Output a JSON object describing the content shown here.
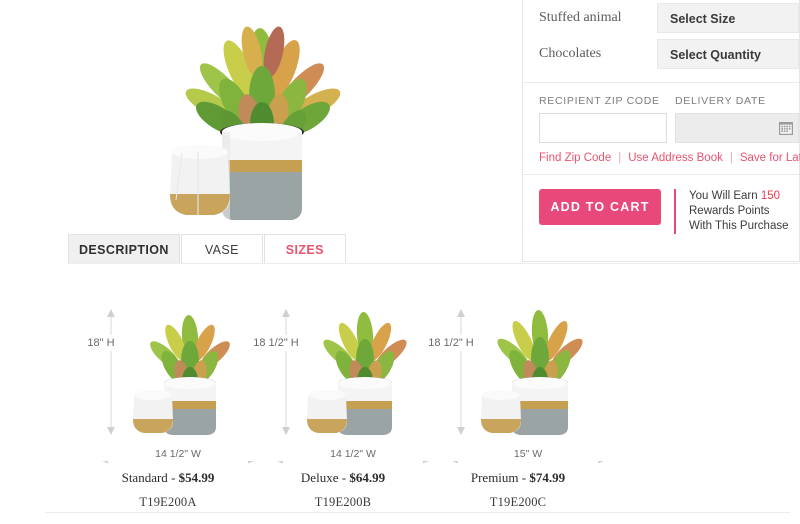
{
  "product": {
    "image_alt": "croton-plant-in-white-grey-gold-ceramic-pot"
  },
  "addons": {
    "rows": [
      {
        "label": "Stuffed animal",
        "select_value": "Select Size"
      },
      {
        "label": "Chocolates",
        "select_value": "Select Quantity"
      }
    ]
  },
  "delivery": {
    "zip_heading": "RECIPIENT ZIP CODE",
    "date_heading": "DELIVERY DATE",
    "zip_value": "",
    "zip_placeholder": "",
    "date_value": "",
    "calendar_icon": "calendar-icon",
    "links": [
      "Find Zip Code",
      "Use Address Book",
      "Save for Later"
    ],
    "link_separator": "|"
  },
  "cart": {
    "add_to_cart_label": "ADD TO CART",
    "rewards_line1_prefix": "You Will Earn ",
    "rewards_points": "150",
    "rewards_line2": "Rewards Points",
    "rewards_line3": "With This Purchase"
  },
  "tabs": [
    {
      "label": "DESCRIPTION",
      "state": "grey"
    },
    {
      "label": "VASE",
      "state": "normal"
    },
    {
      "label": "SIZES",
      "state": "active"
    }
  ],
  "sizes": [
    {
      "height_label": "18\" H",
      "width_label": "14 1/2\" W",
      "name": "Standard",
      "dash": "-",
      "price": "$54.99",
      "sku": "T19E200A"
    },
    {
      "height_label": "18 1/2\" H",
      "width_label": "14 1/2\" W",
      "name": "Deluxe",
      "dash": "-",
      "price": "$64.99",
      "sku": "T19E200B"
    },
    {
      "height_label": "18 1/2\" H",
      "width_label": "15\" W",
      "name": "Premium",
      "dash": "-",
      "price": "$74.99",
      "sku": "T19E200C"
    }
  ],
  "colors": {
    "accent_pink": "#e8487a",
    "link_pink": "#e8536f",
    "points_red": "#ec3b4e",
    "tab_grey": "#f0f0f0",
    "field_grey": "#f2f2f2"
  }
}
